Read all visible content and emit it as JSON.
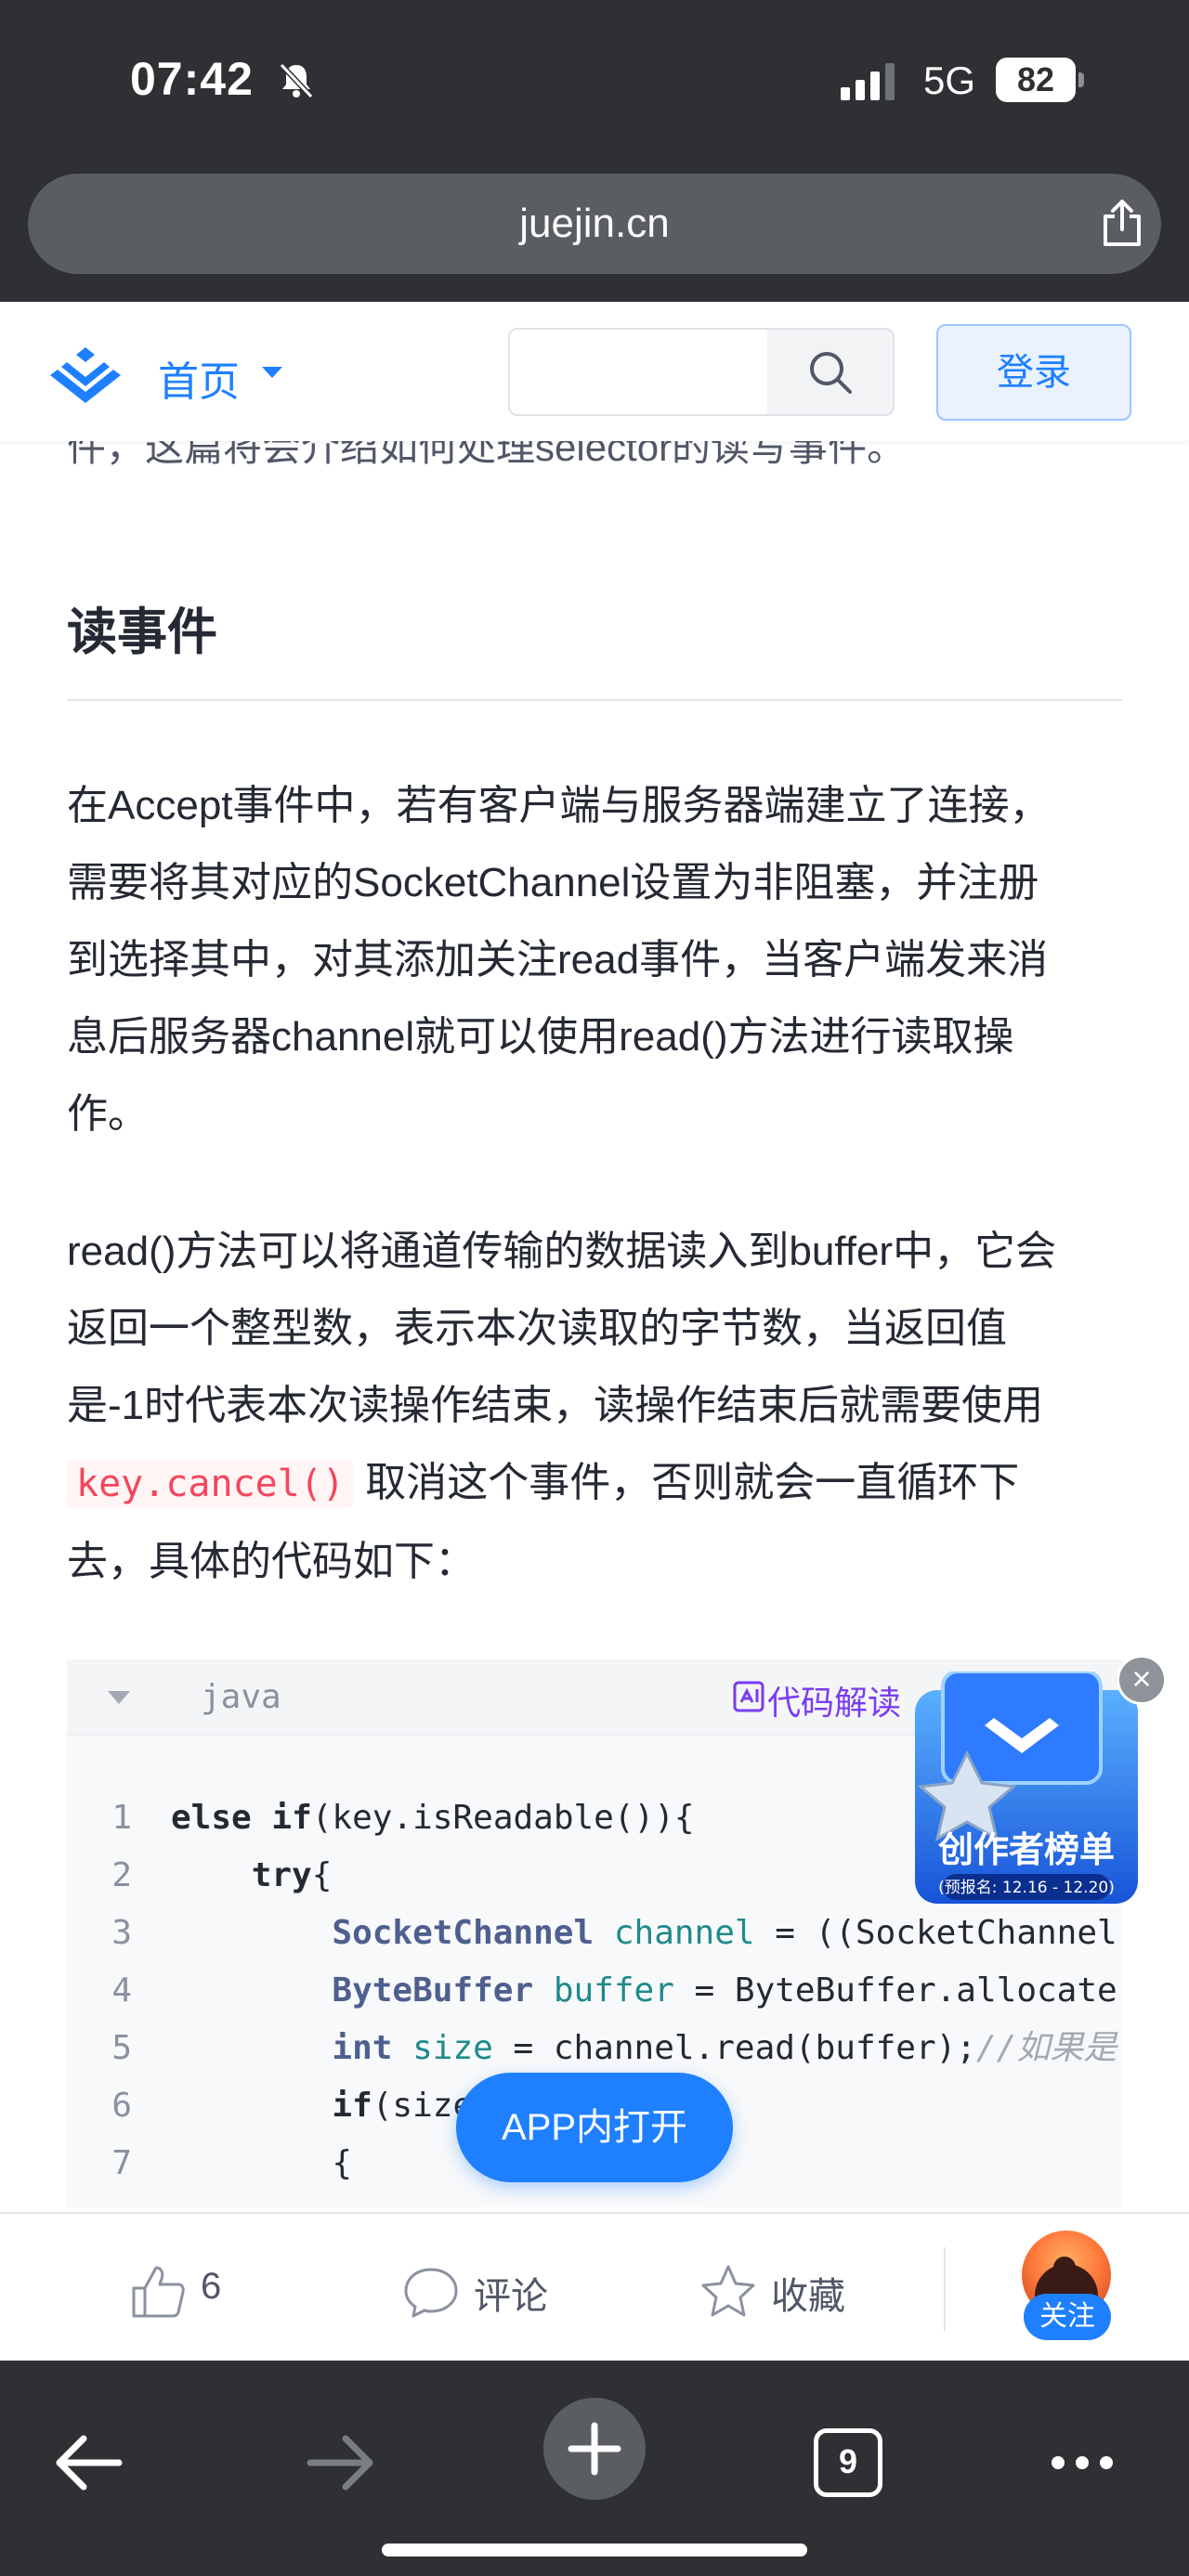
{
  "status_bar": {
    "time": "07:42",
    "network": "5G",
    "battery": "82"
  },
  "browser": {
    "url": "juejin.cn",
    "tab_count": "9"
  },
  "header": {
    "nav_home": "首页",
    "search_placeholder": "",
    "login_label": "登录"
  },
  "article": {
    "prev_line": "件，这篇将会介绍如何处理selector的读写事件。",
    "heading": "读事件",
    "para1": [
      "在Accept事件中，若有客户端与服务器端建立了连接，",
      "需要将其对应的SocketChannel设置为非阻塞，并注册",
      "到选择其中，对其添加关注read事件，当客户端发来消",
      "息后服务器channel就可以使用read()方法进行读取操",
      "作。"
    ],
    "para2": {
      "line1": "read()方法可以将通道传输的数据读入到buffer中，它会",
      "line2": "返回一个整型数，表示本次读取的字节数，当返回值",
      "line3": "是-1时代表本次读操作结束，读操作结束后就需要使用",
      "line4_code": "key.cancel()",
      "line4_text": "取消这个事件，否则就会一直循环下",
      "line5": "去，具体的代码如下："
    }
  },
  "code_block": {
    "language": "java",
    "ai_label": "代码解读",
    "line_numbers": [
      "1",
      "2",
      "3",
      "4",
      "5",
      "6",
      "7"
    ]
  },
  "banner": {
    "title": "创作者榜单",
    "subtitle": "(预报名: 12.16 - 12.20)"
  },
  "floating_button": {
    "label": "APP内打开"
  },
  "action_bar": {
    "like_count": "6",
    "comment_label": "评论",
    "collect_label": "收藏",
    "follow_label": "关注"
  },
  "colors": {
    "brand_blue": "#1e80ff",
    "browser_chrome": "#2e3033",
    "inline_code": "#f5455c",
    "ai_purple": "#7a3cf0"
  }
}
